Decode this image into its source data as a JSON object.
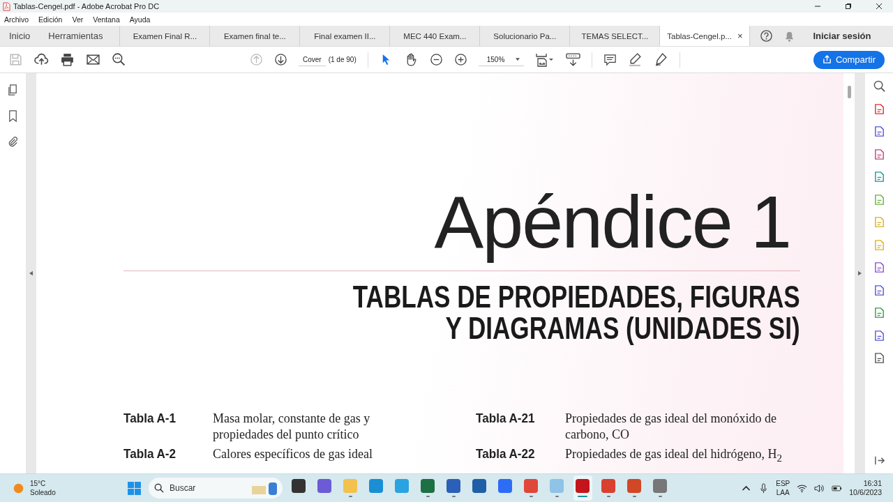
{
  "window": {
    "title": "Tablas-Cengel.pdf - Adobe Acrobat Pro DC"
  },
  "menu": [
    "Archivo",
    "Edición",
    "Ver",
    "Ventana",
    "Ayuda"
  ],
  "nav": [
    "Inicio",
    "Herramientas"
  ],
  "tabs": [
    {
      "label": "Examen Final R...",
      "selected": false
    },
    {
      "label": "Examen final te...",
      "selected": false
    },
    {
      "label": "Final examen II...",
      "selected": false
    },
    {
      "label": "MEC 440 Exam...",
      "selected": false
    },
    {
      "label": "Solucionario Pa...",
      "selected": false
    },
    {
      "label": "TEMAS SELECT...",
      "selected": false
    },
    {
      "label": "Tablas-Cengel.p...",
      "selected": true,
      "close": "×"
    }
  ],
  "signin": "Iniciar sesión",
  "toolbar": {
    "page_label": "Cover",
    "page_count": "(1 de 90)",
    "zoom": "150%",
    "share": "Compartir"
  },
  "document": {
    "title": "Apéndice 1",
    "heading": [
      "TABLAS DE PROPIEDADES, FIGURAS",
      "Y DIAGRAMAS (UNIDADES SI)"
    ],
    "tables": [
      {
        "label": "Tabla A-1",
        "text": "Masa molar, constante de gas y propiedades del punto crítico"
      },
      {
        "label": "Tabla A-21",
        "text": "Propiedades de gas ideal del monóxido de carbono, CO"
      },
      {
        "label": "Tabla A-2",
        "text": "Calores específicos de gas ideal"
      },
      {
        "label": "Tabla A-22",
        "text": "Propiedades de gas ideal del hidrógeno, H$_{2}$"
      }
    ]
  },
  "taskbar": {
    "weather": {
      "temp": "15°C",
      "condition": "Soleado"
    },
    "search": "Buscar",
    "apps": [
      {
        "kind": "taskview",
        "running": false,
        "selected": false
      },
      {
        "kind": "chat",
        "running": false,
        "selected": false
      },
      {
        "kind": "folder",
        "running": true,
        "selected": false
      },
      {
        "kind": "edge",
        "running": false,
        "selected": false
      },
      {
        "kind": "telegram",
        "running": false,
        "selected": false
      },
      {
        "kind": "excel",
        "running": true,
        "selected": false
      },
      {
        "kind": "word",
        "running": true,
        "selected": false
      },
      {
        "kind": "store",
        "running": false,
        "selected": false
      },
      {
        "kind": "zoom",
        "running": false,
        "selected": false
      },
      {
        "kind": "chrome",
        "running": true,
        "selected": false
      },
      {
        "kind": "monitor",
        "running": true,
        "selected": false
      },
      {
        "kind": "acrobat",
        "running": true,
        "selected": true
      },
      {
        "kind": "reader",
        "running": true,
        "selected": false
      },
      {
        "kind": "powerpoint",
        "running": true,
        "selected": false
      },
      {
        "kind": "phone",
        "running": true,
        "selected": false
      }
    ],
    "language": [
      "ESP",
      "LAA"
    ],
    "time": "16:31",
    "date": "10/6/2023"
  }
}
